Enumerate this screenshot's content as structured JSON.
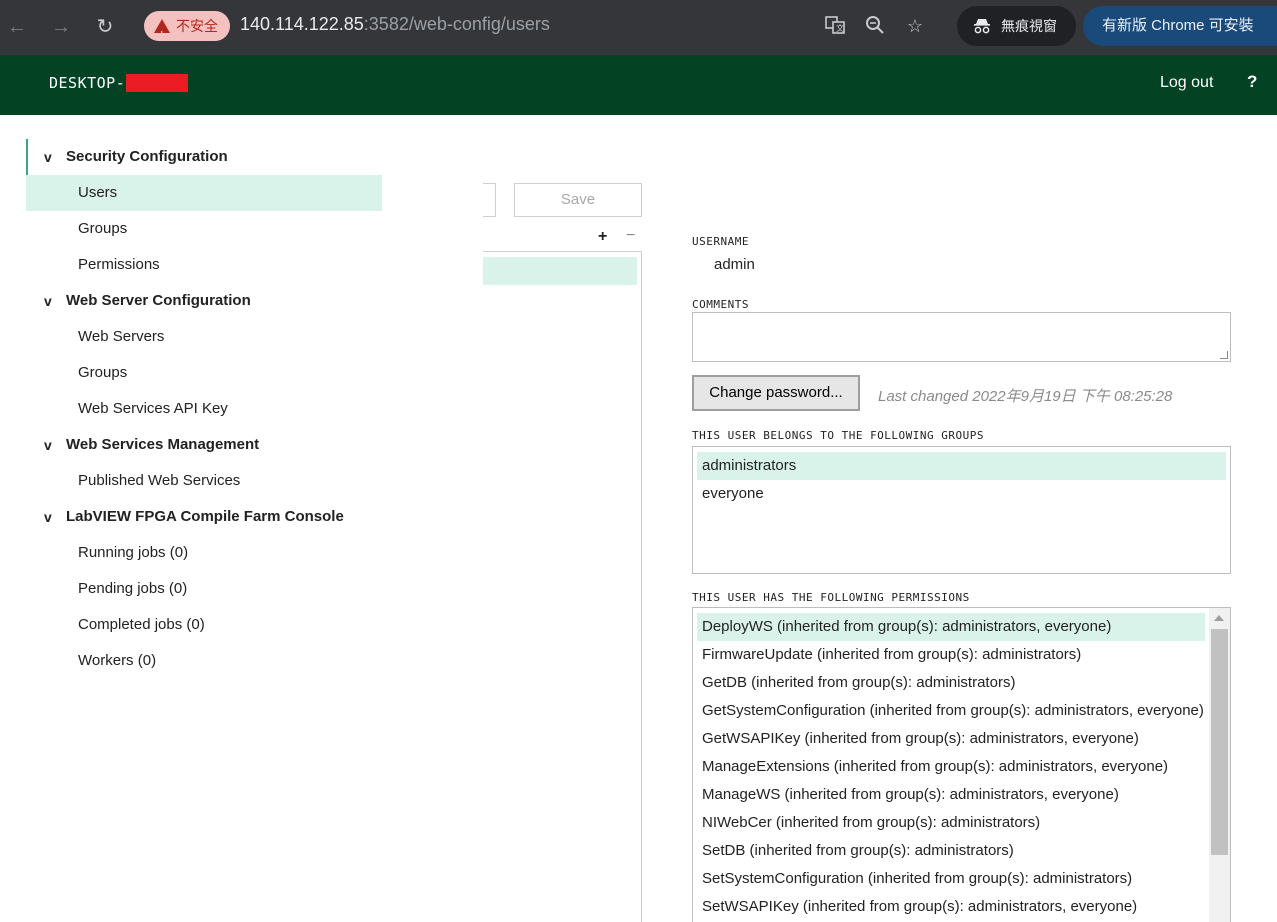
{
  "browser": {
    "security_label": "不安全",
    "url_host": "140.114.122.85",
    "url_rest": ":3582/web-config/users",
    "incognito_label": "無痕視窗",
    "update_label": "有新版 Chrome 可安裝"
  },
  "header": {
    "hostname": "DESKTOP-",
    "logout": "Log out",
    "help": "?"
  },
  "sidebar": {
    "sections": [
      {
        "title": "Security Configuration",
        "items": [
          "Users",
          "Groups",
          "Permissions"
        ]
      },
      {
        "title": "Web Server Configuration",
        "items": [
          "Web Servers",
          "Groups",
          "Web Services API Key"
        ]
      },
      {
        "title": "Web Services Management",
        "items": [
          "Published Web Services"
        ]
      },
      {
        "title": "LabVIEW FPGA Compile Farm Console",
        "items": [
          "Running jobs (0)",
          "Pending jobs (0)",
          "Completed jobs (0)",
          "Workers (0)"
        ]
      }
    ],
    "active_item": "Users"
  },
  "list_toolbar": {
    "save_label": "Save",
    "add_symbol": "+",
    "remove_symbol": "−"
  },
  "detail": {
    "username_label": "USERNAME",
    "username": "admin",
    "comments_label": "COMMENTS",
    "comments_value": "",
    "change_password": "Change password...",
    "last_changed": "Last changed 2022年9月19日 下午 08:25:28",
    "groups_label": "THIS USER BELONGS TO THE FOLLOWING GROUPS",
    "groups": [
      "administrators",
      "everyone"
    ],
    "permissions_label": "THIS USER HAS THE FOLLOWING PERMISSIONS",
    "permissions": [
      "DeployWS (inherited from group(s): administrators, everyone)",
      "FirmwareUpdate (inherited from group(s): administrators)",
      "GetDB (inherited from group(s): administrators)",
      "GetSystemConfiguration (inherited from group(s): administrators, everyone)",
      "GetWSAPIKey (inherited from group(s): administrators, everyone)",
      "ManageExtensions (inherited from group(s): administrators, everyone)",
      "ManageWS (inherited from group(s): administrators, everyone)",
      "NIWebCer (inherited from group(s): administrators)",
      "SetDB (inherited from group(s): administrators)",
      "SetSystemConfiguration (inherited from group(s): administrators)",
      "SetWSAPIKey (inherited from group(s): administrators, everyone)"
    ]
  },
  "colors": {
    "header_bg": "#034222",
    "selection_bg": "#d9f2ea",
    "accent_rule": "#3aa77f",
    "redaction": "#ec1c24"
  }
}
